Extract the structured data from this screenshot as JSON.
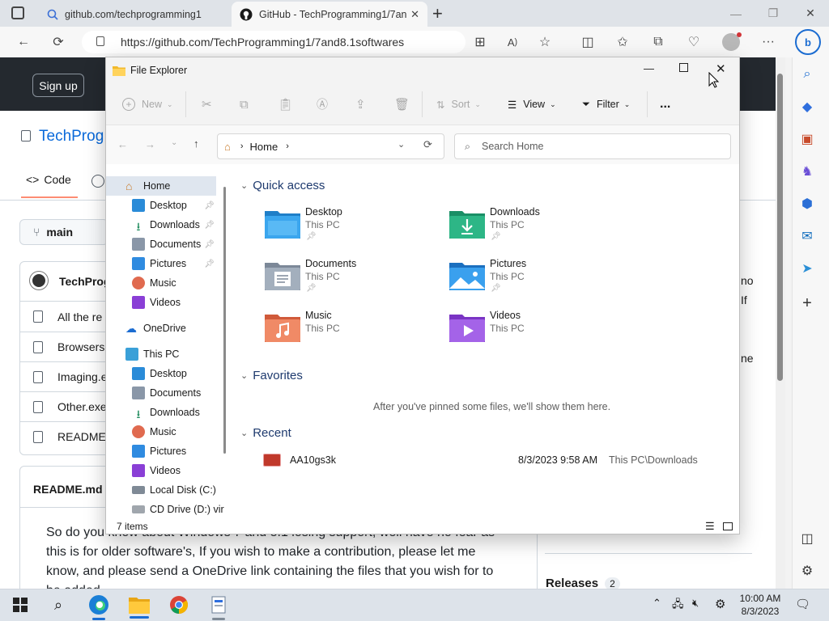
{
  "browser": {
    "tabs": [
      {
        "title": "github.com/techprogramming1"
      },
      {
        "title": "GitHub - TechProgramming1/7an"
      }
    ],
    "url": "https://github.com/TechProgramming1/7and8.1softwares"
  },
  "github": {
    "signup": "Sign up",
    "repo_name": "TechProg",
    "tab_code": "Code",
    "branch": "main",
    "owner": "TechProg",
    "files": [
      "All the re",
      "Browsers.",
      "Imaging.e",
      "Other.exe",
      "README."
    ],
    "readme_title": "README.md",
    "readme_text_1": "So do you know about Windows 7 and 8.1 losing support, well have no fear as",
    "readme_text_2": "this is for older software's, If you wish to make a contribution, please let me",
    "readme_text_3": "know, and please send a OneDrive link containing the files that you wish for to",
    "readme_text_4": "be added.",
    "side_fragments": [
      "no",
      "If",
      "ne"
    ],
    "releases_label": "Releases",
    "releases_count": "2"
  },
  "explorer": {
    "title": "File Explorer",
    "commands": {
      "new": "New",
      "sort": "Sort",
      "view": "View",
      "filter": "Filter",
      "more": "..."
    },
    "path_home": "Home",
    "search_placeholder": "Search Home",
    "nav": {
      "home": "Home",
      "quick": [
        "Desktop",
        "Downloads",
        "Documents",
        "Pictures",
        "Music",
        "Videos"
      ],
      "onedrive": "OneDrive",
      "thispc": "This PC",
      "pc_items": [
        "Desktop",
        "Documents",
        "Downloads",
        "Music",
        "Pictures",
        "Videos",
        "Local Disk (C:)",
        "CD Drive (D:) vir"
      ]
    },
    "quick_access_label": "Quick access",
    "quick_access": [
      {
        "name": "Desktop",
        "location": "This PC"
      },
      {
        "name": "Downloads",
        "location": "This PC"
      },
      {
        "name": "Documents",
        "location": "This PC"
      },
      {
        "name": "Pictures",
        "location": "This PC"
      },
      {
        "name": "Music",
        "location": "This PC"
      },
      {
        "name": "Videos",
        "location": "This PC"
      }
    ],
    "favorites_label": "Favorites",
    "favorites_empty": "After you've pinned some files, we'll show them here.",
    "recent_label": "Recent",
    "recent": [
      {
        "name": "AA10gs3k",
        "date": "8/3/2023 9:58 AM",
        "location": "This PC\\Downloads"
      }
    ],
    "status": "7 items"
  },
  "taskbar": {
    "time": "10:00 AM",
    "date": "8/3/2023"
  }
}
